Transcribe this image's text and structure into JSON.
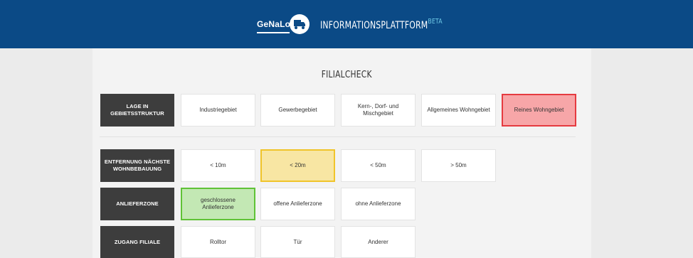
{
  "header": {
    "logo_text": "GeNaLog",
    "platform_title": "INFORMATIONSPLATTFORM",
    "beta_label": "BETA"
  },
  "page": {
    "title": "FILIALCHECK"
  },
  "colors": {
    "header_bg": "#0b4a86",
    "label_bg": "#3d3d3d",
    "selected_red": "#f7a6a8",
    "selected_yellow": "#f8e6a3",
    "selected_green": "#c3e8b4"
  },
  "criteria": {
    "lage": {
      "label": "LAGE IN GEBIETSSTRUKTUR",
      "options": [
        "Industriegebiet",
        "Gewerbegebiet",
        "Kern-, Dorf- und Mischgebiet",
        "Allgemeines Wohngebiet",
        "Reines Wohngebiet"
      ],
      "selected": "Reines Wohngebiet"
    },
    "entfernung": {
      "label": "ENTFERNUNG NÄCHSTE WOHNBEBAUUNG",
      "options": [
        "< 10m",
        "< 20m",
        "< 50m",
        "> 50m"
      ],
      "selected": "< 20m"
    },
    "anlieferzone": {
      "label": "ANLIEFERZONE",
      "options": [
        "geschlossene Anlieferzone",
        "offene Anlieferzone",
        "ohne Anlieferzone"
      ],
      "selected": "geschlossene Anlieferzone"
    },
    "zugang": {
      "label": "ZUGANG FILIALE",
      "options": [
        "Rolltor",
        "Tür",
        "Anderer"
      ]
    }
  }
}
